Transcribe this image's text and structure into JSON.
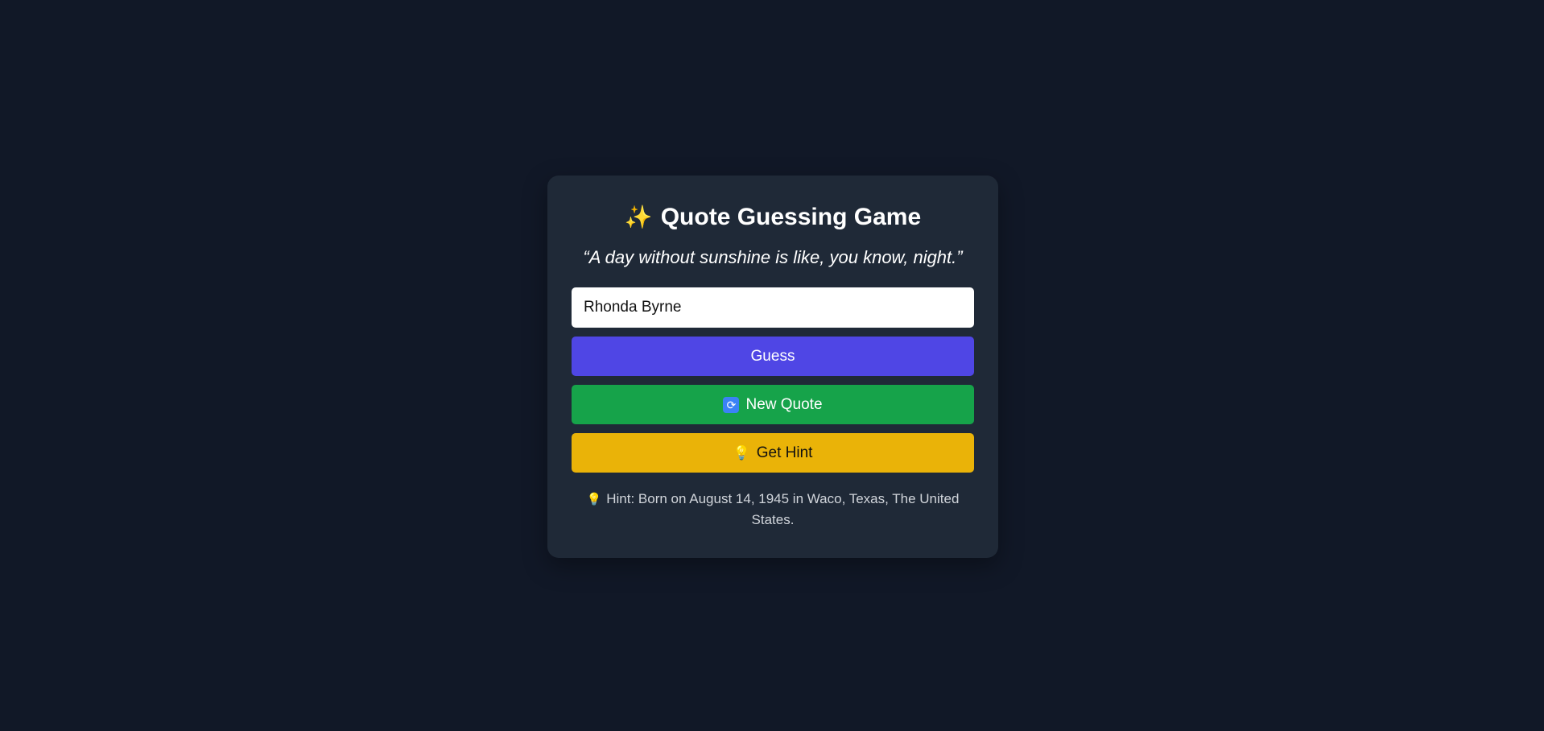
{
  "title": {
    "icon": "sparkles-icon",
    "icon_glyph": "✨",
    "text": "Quote Guessing Game"
  },
  "quote": {
    "text": "“A day without sunshine is like, you know, night.”"
  },
  "guess_input": {
    "value": "Rhonda Byrne"
  },
  "buttons": {
    "guess_label": "Guess",
    "new_quote": {
      "icon": "refresh-icon",
      "icon_glyph": "🔄",
      "label": "New Quote"
    },
    "hint": {
      "icon": "lightbulb-icon",
      "icon_glyph": "💡",
      "label": "Get Hint"
    }
  },
  "hint": {
    "icon": "lightbulb-icon",
    "icon_glyph": "💡",
    "text": "Hint: Born on August 14, 1945 in Waco, Texas, The United States."
  },
  "colors": {
    "background": "#111827",
    "card": "#1f2937",
    "guess_button": "#4f46e5",
    "new_quote_button": "#16a34a",
    "hint_button": "#eab308"
  }
}
